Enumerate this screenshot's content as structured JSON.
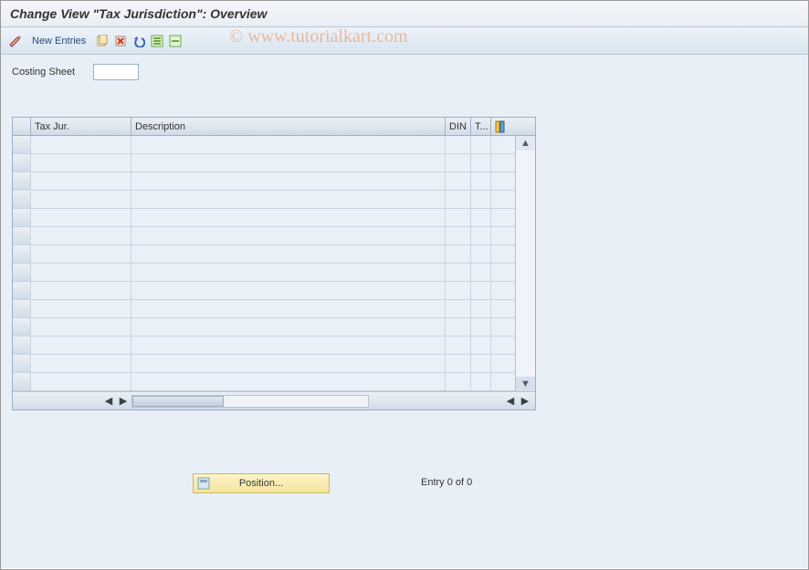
{
  "title": "Change View \"Tax Jurisdiction\": Overview",
  "watermark": "© www.tutorialkart.com",
  "toolbar": {
    "new_entries": "New Entries"
  },
  "fields": {
    "costing_sheet_label": "Costing Sheet",
    "costing_sheet_value": ""
  },
  "table": {
    "headers": {
      "tax_jur": "Tax Jur.",
      "description": "Description",
      "din": "DIN",
      "t": "T..."
    },
    "row_count": 14
  },
  "footer": {
    "position_label": "Position...",
    "entry_text": "Entry 0 of 0"
  }
}
